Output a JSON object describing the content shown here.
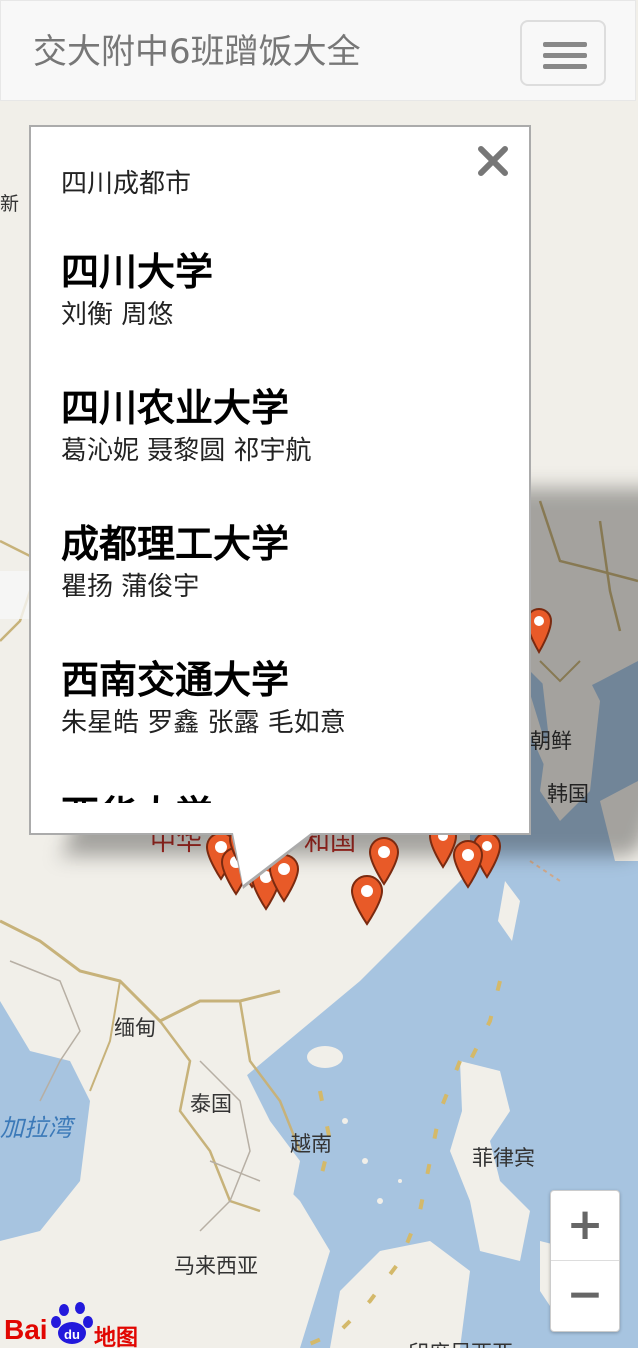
{
  "navbar": {
    "brand": "交大附中6班蹭饭大全",
    "menu_icon": "hamburger-menu-icon"
  },
  "map": {
    "labels": {
      "korea_north": "朝鲜",
      "korea_south": "韩国",
      "myanmar": "缅甸",
      "thailand": "泰国",
      "vietnam": "越南",
      "philippines": "菲律宾",
      "malaysia": "马来西亚",
      "bay_of_bengal": "加拉湾",
      "china_partial_left": "中华",
      "china_partial_right": "和国",
      "indonesia_partial": "印度尼西亚",
      "edge_fragment": "新"
    },
    "zoom": {
      "in_label": "+",
      "out_label": "−"
    },
    "logo": {
      "bai": "Bai",
      "du": "du",
      "map_text": "地图"
    },
    "colors": {
      "land": "#f1efe9",
      "sea": "#a7c4e0",
      "border_province": "#cbb26a",
      "marker": "#e85a28"
    }
  },
  "popup": {
    "title": "四川成都市",
    "close_icon": "close-icon",
    "universities": [
      {
        "name": "四川大学",
        "students": "刘衡 周悠"
      },
      {
        "name": "四川农业大学",
        "students": "葛沁妮 聂黎圆 祁宇航"
      },
      {
        "name": "成都理工大学",
        "students": "瞿扬 蒲俊宇"
      },
      {
        "name": "西南交通大学",
        "students": "朱星皓 罗鑫 张露 毛如意"
      },
      {
        "name": "西华大学",
        "students": ""
      }
    ]
  }
}
